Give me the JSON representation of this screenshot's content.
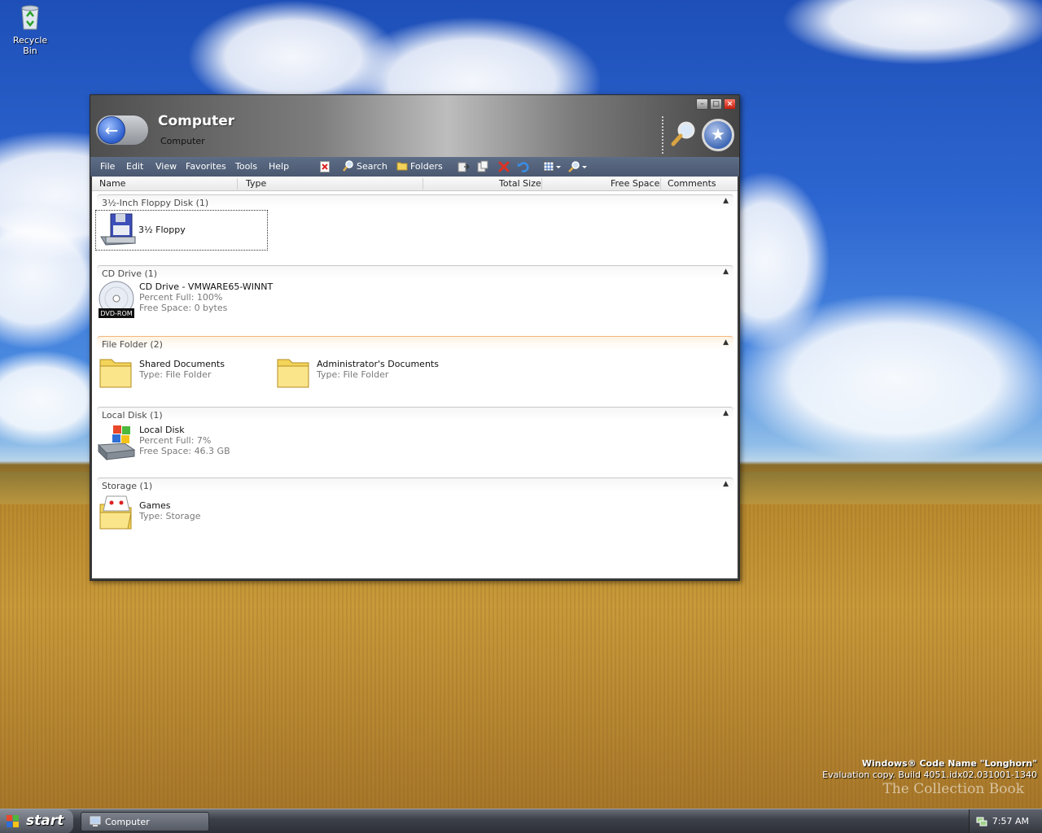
{
  "desktop": {
    "recycle_bin_label": "Recycle Bin",
    "watermark_line1": "Windows® Code Name \"Longhorn\"",
    "watermark_line2": "Evaluation copy. Build 4051.idx02.031001-1340",
    "brand_text": "The Collection Book"
  },
  "window": {
    "title": "Computer",
    "subtitle": "Computer",
    "controls": {
      "minimize": "–",
      "maximize": "□",
      "close": "×"
    }
  },
  "menu": {
    "items": [
      "File",
      "Edit",
      "View",
      "Favorites",
      "Tools",
      "Help"
    ]
  },
  "toolbar": {
    "search_label": "Search",
    "folders_label": "Folders"
  },
  "columns": [
    "Name",
    "Type",
    "Total Size",
    "Free Space",
    "Comments"
  ],
  "groups": [
    {
      "title": "3½-Inch Floppy Disk (1)",
      "items": [
        {
          "name": "3½ Floppy",
          "icon": "floppy-drive-icon"
        }
      ]
    },
    {
      "title": "CD Drive (1)",
      "items": [
        {
          "name": "CD Drive - VMWARE65-WINNT",
          "line1": "Percent Full: 100%",
          "line2": "Free Space: 0 bytes",
          "icon_label": "DVD-ROM",
          "icon": "dvd-drive-icon"
        }
      ]
    },
    {
      "title": "File Folder (2)",
      "items": [
        {
          "name": "Shared Documents",
          "line1": "Type: File Folder",
          "icon": "folder-icon"
        },
        {
          "name": "Administrator's Documents",
          "line1": "Type: File Folder",
          "icon": "folder-icon"
        }
      ]
    },
    {
      "title": "Local Disk (1)",
      "items": [
        {
          "name": "Local Disk",
          "line1": "Percent Full: 7%",
          "line2": "Free Space: 46.3 GB",
          "icon": "hard-drive-icon"
        }
      ]
    },
    {
      "title": "Storage (1)",
      "items": [
        {
          "name": "Games",
          "line1": "Type: Storage",
          "icon": "storage-folder-icon"
        }
      ]
    }
  ],
  "taskbar": {
    "start_label": "start",
    "task_label": "Computer",
    "clock": "7:57 AM"
  }
}
